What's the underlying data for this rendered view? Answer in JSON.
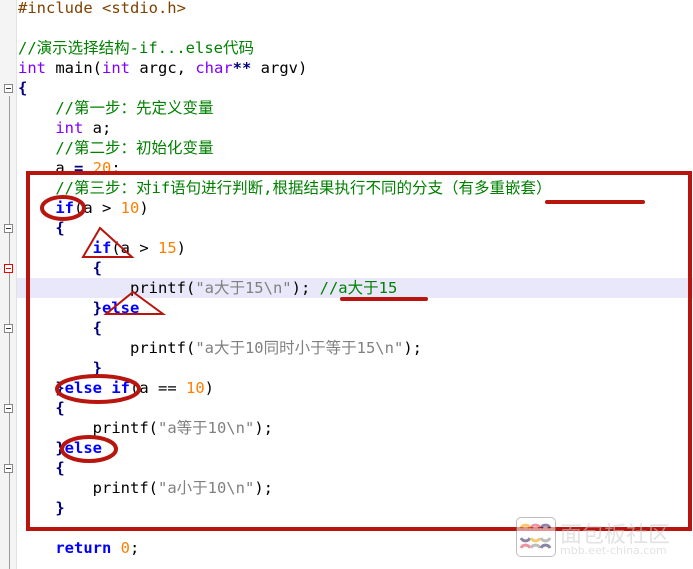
{
  "editor": {
    "lines": [
      [
        [
          "#include <stdio.h>",
          "pp"
        ]
      ],
      [],
      [
        [
          "//演示选择结构-if...else代码",
          "cm"
        ]
      ],
      [
        [
          "int",
          "kw"
        ],
        [
          " main(",
          "tx"
        ],
        [
          "int",
          "kw"
        ],
        [
          " argc, ",
          "tx"
        ],
        [
          "char",
          "kw"
        ],
        [
          "**",
          "op"
        ],
        [
          " argv)",
          "tx"
        ]
      ],
      [
        [
          "{",
          "op"
        ]
      ],
      [
        [
          "    //第一步：先定义变量",
          "cm"
        ]
      ],
      [
        [
          "    ",
          "tx"
        ],
        [
          "int",
          "kw"
        ],
        [
          " a;",
          "tx"
        ]
      ],
      [
        [
          "    //第二步：初始化变量",
          "cm"
        ]
      ],
      [
        [
          "    a ",
          "tx"
        ],
        [
          "=",
          "op"
        ],
        [
          " ",
          "tx"
        ],
        [
          "20",
          "num"
        ],
        [
          ";",
          "tx"
        ]
      ],
      [
        [
          "    //第三步：对if语句进行判断,根据结果执行不同的分支（有多重嵌套）",
          "cm"
        ]
      ],
      [
        [
          "    ",
          "tx"
        ],
        [
          "if",
          "kb"
        ],
        [
          "(a > ",
          "tx"
        ],
        [
          "10",
          "num"
        ],
        [
          ")",
          "tx"
        ]
      ],
      [
        [
          "    {",
          "op"
        ]
      ],
      [
        [
          "        ",
          "tx"
        ],
        [
          "if",
          "kb"
        ],
        [
          "(a > ",
          "tx"
        ],
        [
          "15",
          "num"
        ],
        [
          ")",
          "tx"
        ]
      ],
      [
        [
          "        {",
          "op"
        ]
      ],
      [
        [
          "            printf(",
          "tx"
        ],
        [
          "\"a大于15\\n\"",
          "str"
        ],
        [
          "); ",
          "tx"
        ],
        [
          "//a大于15",
          "cm"
        ]
      ],
      [
        [
          "        }",
          "op"
        ],
        [
          "else",
          "kb"
        ]
      ],
      [
        [
          "        {",
          "op"
        ]
      ],
      [
        [
          "            printf(",
          "tx"
        ],
        [
          "\"a大于10同时小于等于15\\n\"",
          "str"
        ],
        [
          ");",
          "tx"
        ]
      ],
      [
        [
          "        }",
          "op"
        ]
      ],
      [
        [
          "    }",
          "op"
        ],
        [
          "else if",
          "kb"
        ],
        [
          "(a == ",
          "tx"
        ],
        [
          "10",
          "num"
        ],
        [
          ")",
          "tx"
        ]
      ],
      [
        [
          "    {",
          "op"
        ]
      ],
      [
        [
          "        printf(",
          "tx"
        ],
        [
          "\"a等于10\\n\"",
          "str"
        ],
        [
          ");",
          "tx"
        ]
      ],
      [
        [
          "    }",
          "op"
        ],
        [
          "else",
          "kb"
        ]
      ],
      [
        [
          "    {",
          "op"
        ]
      ],
      [
        [
          "        printf(",
          "tx"
        ],
        [
          "\"a小于10\\n\"",
          "str"
        ],
        [
          ");",
          "tx"
        ]
      ],
      [
        [
          "    }",
          "op"
        ]
      ],
      [],
      [
        [
          "    ",
          "tx"
        ],
        [
          "return",
          "kb"
        ],
        [
          " ",
          "tx"
        ],
        [
          "0",
          "num"
        ],
        [
          ";",
          "tx"
        ]
      ]
    ],
    "highlighted_line": 14
  },
  "annotation_color": "#b8150e",
  "watermark": {
    "title": "面包板社区",
    "url": "mbb.eet-china.com"
  }
}
